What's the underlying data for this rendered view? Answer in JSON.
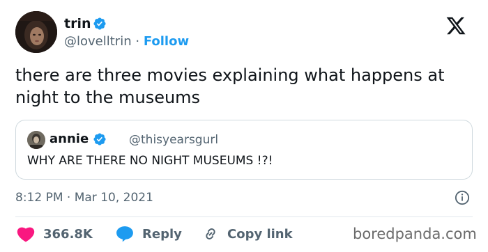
{
  "author": {
    "name": "trin",
    "handle": "@lovelltrin",
    "separator": "·",
    "follow_label": "Follow"
  },
  "tweet": {
    "text": "there are three movies explaining what happens at night to the museums"
  },
  "quoted": {
    "name": "annie",
    "handle": "@thisyearsgurl",
    "text": "WHY ARE THERE NO NIGHT MUSEUMS !?!"
  },
  "meta": {
    "timestamp": "8:12 PM · Mar 10, 2021"
  },
  "actions": {
    "likes": "366.8K",
    "reply_label": "Reply",
    "copy_link_label": "Copy link"
  },
  "watermark": "boredpanda.com",
  "colors": {
    "accent": "#1d9bf0",
    "like": "#f91880",
    "muted": "#536471",
    "text": "#0f1419"
  },
  "icons": [
    "verified-badge-icon",
    "x-logo-icon",
    "info-icon",
    "heart-icon",
    "reply-icon",
    "link-icon"
  ]
}
